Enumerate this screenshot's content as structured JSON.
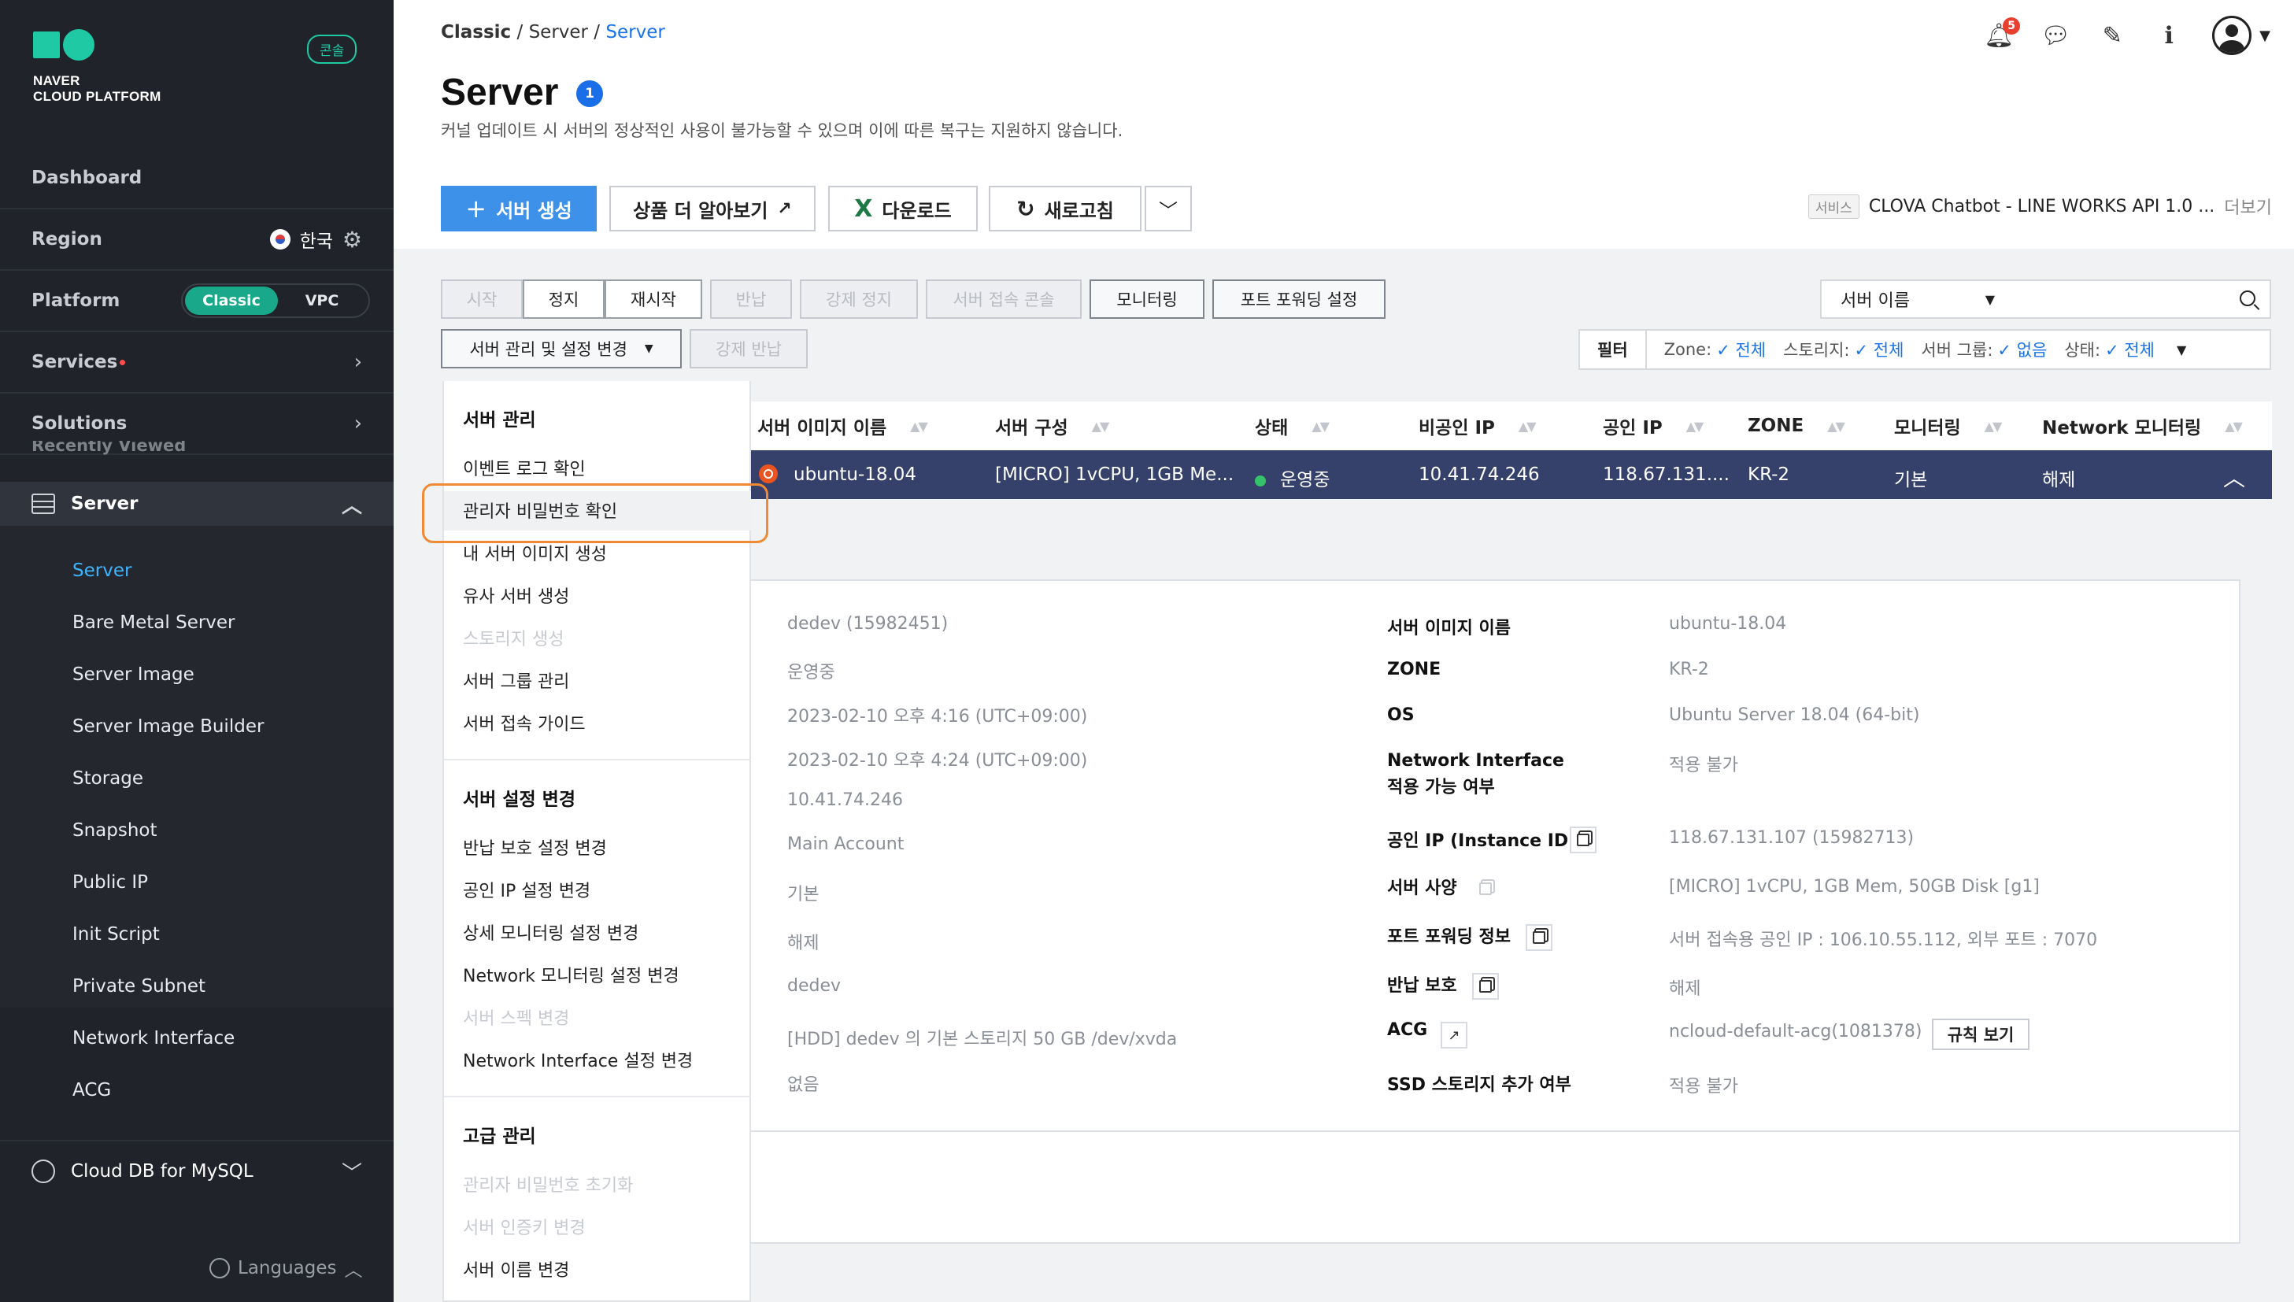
{
  "sidebar": {
    "logo_line1": "NAVER",
    "logo_line2": "CLOUD PLATFORM",
    "console_badge": "콘솔",
    "dashboard": "Dashboard",
    "region_label": "Region",
    "region_value": "한국",
    "platform_label": "Platform",
    "platform_options": [
      "Classic",
      "VPC"
    ],
    "services": "Services",
    "solutions": "Solutions",
    "recently_viewed": "Recently Viewed",
    "server_section": "Server",
    "server_items": [
      "Server",
      "Bare Metal Server",
      "Server Image",
      "Server Image Builder",
      "Storage",
      "Snapshot",
      "Public IP",
      "Init Script",
      "Private Subnet",
      "Network Interface",
      "ACG"
    ],
    "cloud_db": "Cloud DB for MySQL",
    "languages": "Languages"
  },
  "header": {
    "breadcrumb": [
      "Classic",
      "Server",
      "Server"
    ],
    "title": "Server",
    "info_badge": "1",
    "subtitle": "커널 업데이트 시 서버의 정상적인 사용이 불가능할 수 있으며 이에 따른 복구는 지원하지 않습니다.",
    "notification_count": "5"
  },
  "toolbar": {
    "create": "서버 생성",
    "learn_more": "상품 더 알아보기",
    "download": "다운로드",
    "refresh": "새로고침",
    "service_tag": "서비스",
    "service_name": "CLOVA Chatbot - LINE WORKS API 1.0 ...",
    "service_more": "더보기"
  },
  "actions": {
    "start": "시작",
    "stop": "정지",
    "restart": "재시작",
    "return": "반납",
    "force_stop": "강제 정지",
    "console": "서버 접속 콘솔",
    "monitoring": "모니터링",
    "port_forwarding": "포트 포워딩 설정",
    "manage": "서버 관리 및 설정 변경",
    "force_return": "강제 반납"
  },
  "search": {
    "select_value": "서버 이름"
  },
  "filter": {
    "label": "필터",
    "items": [
      {
        "key": "Zone:",
        "value": "전체"
      },
      {
        "key": "스토리지:",
        "value": "전체"
      },
      {
        "key": "서버 그룹:",
        "value": "없음"
      },
      {
        "key": "상태:",
        "value": "전체"
      }
    ]
  },
  "table": {
    "columns": [
      "서버 이미지 이름",
      "서버 구성",
      "상태",
      "비공인 IP",
      "공인 IP",
      "ZONE",
      "모니터링",
      "Network 모니터링"
    ],
    "row": {
      "image": "ubuntu-18.04",
      "spec": "[MICRO] 1vCPU, 1GB Me...",
      "status": "운영중",
      "private_ip": "10.41.74.246",
      "public_ip": "118.67.131....",
      "zone": "KR-2",
      "monitoring": "기본",
      "net_monitoring": "해제"
    }
  },
  "detail": {
    "left_values": [
      "dedev (15982451)",
      "운영중",
      "2023-02-10 오후 4:16 (UTC+09:00)",
      "2023-02-10 오후 4:24 (UTC+09:00)",
      "10.41.74.246",
      "Main Account",
      "기본",
      "해제",
      "dedev",
      "[HDD] dedev 의 기본 스토리지  50 GB /dev/xvda",
      "없음"
    ],
    "right": [
      {
        "key": "서버 이미지 이름",
        "value": "ubuntu-18.04"
      },
      {
        "key": "ZONE",
        "value": "KR-2"
      },
      {
        "key": "OS",
        "value": "Ubuntu Server 18.04 (64-bit)"
      },
      {
        "key": "Network Interface",
        "key2": "적용 가능 여부",
        "value": "적용 불가"
      },
      {
        "key": "공인 IP (Instance ID)",
        "value": "118.67.131.107 (15982713)"
      },
      {
        "key": "서버 사양",
        "value": "[MICRO] 1vCPU, 1GB Mem, 50GB Disk [g1]"
      },
      {
        "key": "포트 포워딩 정보",
        "value": "서버 접속용 공인 IP : 106.10.55.112, 외부 포트 : 7070"
      },
      {
        "key": "반납 보호",
        "value": "해제"
      },
      {
        "key": "ACG",
        "value": "ncloud-default-acg(1081378)"
      },
      {
        "key": "SSD 스토리지 추가 여부",
        "value": "적용 불가"
      }
    ],
    "rule_button": "규칙 보기"
  },
  "menu": {
    "sections": [
      {
        "title": "서버 관리",
        "items": [
          {
            "label": "이벤트 로그 확인",
            "enabled": true
          },
          {
            "label": "관리자 비밀번호 확인",
            "enabled": true
          },
          {
            "label": "내 서버 이미지 생성",
            "enabled": true
          },
          {
            "label": "유사 서버 생성",
            "enabled": true
          },
          {
            "label": "스토리지 생성",
            "enabled": false
          },
          {
            "label": "서버 그룹 관리",
            "enabled": true
          },
          {
            "label": "서버 접속 가이드",
            "enabled": true
          }
        ]
      },
      {
        "title": "서버 설정 변경",
        "items": [
          {
            "label": "반납 보호 설정 변경",
            "enabled": true
          },
          {
            "label": "공인 IP 설정 변경",
            "enabled": true
          },
          {
            "label": "상세 모니터링 설정 변경",
            "enabled": true
          },
          {
            "label": "Network 모니터링 설정 변경",
            "enabled": true
          },
          {
            "label": "서버 스펙 변경",
            "enabled": false
          },
          {
            "label": "Network Interface 설정 변경",
            "enabled": true
          }
        ]
      },
      {
        "title": "고급 관리",
        "items": [
          {
            "label": "관리자 비밀번호 초기화",
            "enabled": false
          },
          {
            "label": "서버 인증키 변경",
            "enabled": false
          },
          {
            "label": "서버 이름 변경",
            "enabled": true
          }
        ]
      }
    ]
  },
  "colors": {
    "sidebar_bg": "#20232a",
    "accent_teal": "#1ec9a4",
    "primary_blue": "#3d91e8",
    "selected_row": "#35416b",
    "highlight_orange": "#f08a35"
  }
}
